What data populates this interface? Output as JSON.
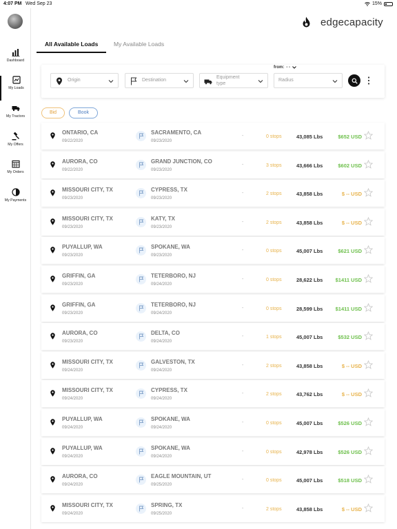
{
  "status": {
    "time": "4:07 PM",
    "date": "Wed Sep 23",
    "battery": "15%"
  },
  "sidebar": {
    "items": [
      {
        "label": "Dashboard",
        "icon": "dashboard-icon"
      },
      {
        "label": "My Loads",
        "icon": "loads-icon"
      },
      {
        "label": "My Tractors",
        "icon": "truck-icon"
      },
      {
        "label": "My Offers",
        "icon": "gavel-icon"
      },
      {
        "label": "My Orders",
        "icon": "calendar-icon"
      },
      {
        "label": "My Payments",
        "icon": "payments-icon"
      }
    ],
    "active_index": 1
  },
  "brand": {
    "name": "edgecapacity"
  },
  "tabs": [
    {
      "label": "All Available Loads"
    },
    {
      "label": "My Available Loads"
    }
  ],
  "filters": {
    "origin": "Origin",
    "destination": "Destination",
    "equipment": "Equipment type",
    "radius": "Radius",
    "from_label": "from:",
    "from_value": "- -"
  },
  "chips": {
    "bid": "Bid",
    "book": "Book"
  },
  "loads": [
    {
      "origin": "ONTARIO, CA",
      "origin_date": "09/22/2020",
      "dest": "SACRAMENTO, CA",
      "dest_date": "09/23/2020",
      "dash": "-",
      "stops": "0 stops",
      "weight": "43,085 Lbs",
      "price": "$652 USD"
    },
    {
      "origin": "AURORA, CO",
      "origin_date": "09/22/2020",
      "dest": "GRAND JUNCTION, CO",
      "dest_date": "09/23/2020",
      "dash": "-",
      "stops": "3 stops",
      "weight": "43,666 Lbs",
      "price": "$602 USD"
    },
    {
      "origin": "MISSOURI CITY, TX",
      "origin_date": "09/23/2020",
      "dest": "CYPRESS, TX",
      "dest_date": "09/23/2020",
      "dash": "-",
      "stops": "2 stops",
      "weight": "43,858 Lbs",
      "price": "$ -- USD"
    },
    {
      "origin": "MISSOURI CITY, TX",
      "origin_date": "09/23/2020",
      "dest": "KATY, TX",
      "dest_date": "09/23/2020",
      "dash": "-",
      "stops": "2 stops",
      "weight": "43,858 Lbs",
      "price": "$ -- USD"
    },
    {
      "origin": "PUYALLUP, WA",
      "origin_date": "09/23/2020",
      "dest": "SPOKANE, WA",
      "dest_date": "09/23/2020",
      "dash": "-",
      "stops": "0 stops",
      "weight": "45,007 Lbs",
      "price": "$621 USD"
    },
    {
      "origin": "GRIFFIN, GA",
      "origin_date": "09/23/2020",
      "dest": "TETERBORO, NJ",
      "dest_date": "09/24/2020",
      "dash": "-",
      "stops": "0 stops",
      "weight": "28,622 Lbs",
      "price": "$1411 USD"
    },
    {
      "origin": "GRIFFIN, GA",
      "origin_date": "09/23/2020",
      "dest": "TETERBORO, NJ",
      "dest_date": "09/24/2020",
      "dash": "-",
      "stops": "0 stops",
      "weight": "28,599 Lbs",
      "price": "$1411 USD"
    },
    {
      "origin": "AURORA, CO",
      "origin_date": "09/23/2020",
      "dest": "DELTA, CO",
      "dest_date": "09/24/2020",
      "dash": "-",
      "stops": "1 stops",
      "weight": "45,007 Lbs",
      "price": "$532 USD"
    },
    {
      "origin": "MISSOURI CITY, TX",
      "origin_date": "09/24/2020",
      "dest": "GALVESTON, TX",
      "dest_date": "09/24/2020",
      "dash": "-",
      "stops": "2 stops",
      "weight": "43,858 Lbs",
      "price": "$ -- USD"
    },
    {
      "origin": "MISSOURI CITY, TX",
      "origin_date": "09/24/2020",
      "dest": "CYPRESS, TX",
      "dest_date": "09/24/2020",
      "dash": "-",
      "stops": "2 stops",
      "weight": "43,762 Lbs",
      "price": "$ -- USD"
    },
    {
      "origin": "PUYALLUP, WA",
      "origin_date": "09/24/2020",
      "dest": "SPOKANE, WA",
      "dest_date": "09/24/2020",
      "dash": "-",
      "stops": "0 stops",
      "weight": "45,007 Lbs",
      "price": "$526 USD"
    },
    {
      "origin": "PUYALLUP, WA",
      "origin_date": "09/24/2020",
      "dest": "SPOKANE, WA",
      "dest_date": "09/24/2020",
      "dash": "-",
      "stops": "0 stops",
      "weight": "42,978 Lbs",
      "price": "$526 USD"
    },
    {
      "origin": "AURORA, CO",
      "origin_date": "09/24/2020",
      "dest": "EAGLE MOUNTAIN, UT",
      "dest_date": "09/25/2020",
      "dash": "-",
      "stops": "0 stops",
      "weight": "45,007 Lbs",
      "price": "$518 USD"
    },
    {
      "origin": "MISSOURI CITY, TX",
      "origin_date": "09/24/2020",
      "dest": "SPRING, TX",
      "dest_date": "09/25/2020",
      "dash": "-",
      "stops": "2 stops",
      "weight": "43,858 Lbs",
      "price": "$ -- USD"
    }
  ],
  "colors": {
    "price": "#6cbf4a",
    "stops": "#e7b24a",
    "bid": "#e2a13a",
    "book": "#4b7cbf",
    "active_tab": "#111111"
  }
}
